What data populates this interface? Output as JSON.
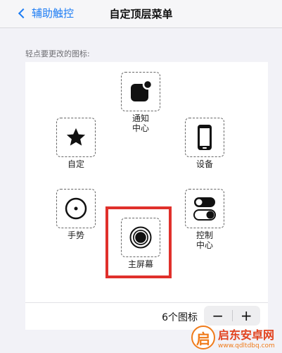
{
  "nav": {
    "back_label": "辅助触控",
    "title": "自定顶层菜单"
  },
  "hint": "轻点要更改的图标:",
  "menu_items": {
    "top": "通知\n中心",
    "left_top": "自定",
    "right_top": "设备",
    "left_bottom": "手势",
    "right_bottom": "控制\n中心",
    "center": "主屏幕"
  },
  "footer": {
    "count_label": "6个图标",
    "minus": "−",
    "plus": "+"
  },
  "watermark": {
    "name": "启东安卓网",
    "url": "www.qdltdbq.com"
  },
  "colors": {
    "accent": "#1c7cf4",
    "highlight_border": "#e0302b",
    "watermark": "#e2431f"
  }
}
